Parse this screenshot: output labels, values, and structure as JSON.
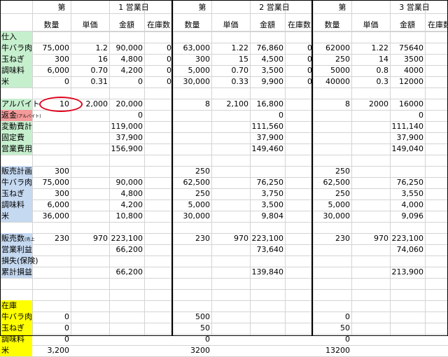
{
  "colors": {
    "green": "#c6efce",
    "blue": "#c5d9f1",
    "pink": "#f49a9a",
    "yellow": "#ffff00",
    "circle": "#e2001a",
    "grid": "#d4d4d4"
  },
  "days": [
    {
      "prefix": "第",
      "title": "1 営業日"
    },
    {
      "prefix": "第",
      "title": "2 営業日"
    },
    {
      "prefix": "第",
      "title": "3 営業日"
    }
  ],
  "column_headers": [
    "数量",
    "単価",
    "金額",
    "在庫数"
  ],
  "rows": [
    {
      "label": "仕入",
      "bg": "green",
      "cells": [
        [
          "",
          "",
          "",
          ""
        ],
        [
          "",
          "",
          "",
          ""
        ],
        [
          "",
          "",
          "",
          ""
        ]
      ]
    },
    {
      "label": "牛バラ肉",
      "bg": "green",
      "cells": [
        [
          "75,000",
          "1.2",
          "90,000",
          "0"
        ],
        [
          "63,000",
          "1.22",
          "76,860",
          "0"
        ],
        [
          "62000",
          "1.22",
          "75640",
          "0"
        ]
      ]
    },
    {
      "label": "玉ねぎ",
      "bg": "green",
      "cells": [
        [
          "300",
          "16",
          "4,800",
          "0"
        ],
        [
          "300",
          "15",
          "4,500",
          "0"
        ],
        [
          "250",
          "14",
          "3500",
          "0"
        ]
      ]
    },
    {
      "label": "調味料",
      "bg": "green",
      "cells": [
        [
          "6,000",
          "0.70",
          "4,200",
          "0"
        ],
        [
          "5,000",
          "0.70",
          "3,500",
          "0"
        ],
        [
          "5000",
          "0.8",
          "4000",
          "0"
        ]
      ]
    },
    {
      "label": "米",
      "bg": "green",
      "cells": [
        [
          "0",
          "0.31",
          "0",
          "0"
        ],
        [
          "30,000",
          "0.33",
          "9,900",
          "0"
        ],
        [
          "40000",
          "0.3",
          "12000",
          "0"
        ]
      ]
    },
    {
      "label": "",
      "bg": "",
      "cells": [
        [
          "",
          "",
          "",
          ""
        ],
        [
          "",
          "",
          "",
          ""
        ],
        [
          "",
          "",
          "",
          ""
        ]
      ]
    },
    {
      "label": "アルバイト",
      "bg": "green",
      "cells": [
        [
          "10",
          "2,000",
          "20,000",
          ""
        ],
        [
          "8",
          "2,100",
          "16,800",
          ""
        ],
        [
          "8",
          "2000",
          "16000",
          ""
        ]
      ]
    },
    {
      "label": "返金",
      "label_small": "(アルバイト)",
      "bg": "pink",
      "cells": [
        [
          "",
          "",
          "0",
          ""
        ],
        [
          "",
          "",
          "0",
          ""
        ],
        [
          "",
          "",
          "0",
          ""
        ]
      ]
    },
    {
      "label": "変動費計",
      "bg": "green",
      "cells": [
        [
          "",
          "",
          "119,000",
          ""
        ],
        [
          "",
          "",
          "111,560",
          ""
        ],
        [
          "",
          "",
          "111,140",
          ""
        ]
      ]
    },
    {
      "label": "固定費",
      "bg": "green",
      "cells": [
        [
          "",
          "",
          "37,900",
          ""
        ],
        [
          "",
          "",
          "37,900",
          ""
        ],
        [
          "",
          "",
          "37,900",
          ""
        ]
      ]
    },
    {
      "label": "営業費用",
      "bg": "green",
      "cells": [
        [
          "",
          "",
          "156,900",
          ""
        ],
        [
          "",
          "",
          "149,460",
          ""
        ],
        [
          "",
          "",
          "149,040",
          ""
        ]
      ]
    },
    {
      "label": "",
      "bg": "",
      "cells": [
        [
          "",
          "",
          "",
          ""
        ],
        [
          "",
          "",
          "",
          ""
        ],
        [
          "",
          "",
          "",
          ""
        ]
      ]
    },
    {
      "label": "販売計画",
      "bg": "blue",
      "cells": [
        [
          "300",
          "",
          "",
          ""
        ],
        [
          "250",
          "",
          "",
          ""
        ],
        [
          "250",
          "",
          "",
          ""
        ]
      ]
    },
    {
      "label": "牛バラ肉",
      "bg": "blue",
      "cells": [
        [
          "75,000",
          "",
          "90,000",
          ""
        ],
        [
          "62,500",
          "",
          "76,250",
          ""
        ],
        [
          "62,500",
          "",
          "76,250",
          ""
        ]
      ]
    },
    {
      "label": "玉ねぎ",
      "bg": "blue",
      "cells": [
        [
          "300",
          "",
          "4,800",
          ""
        ],
        [
          "250",
          "",
          "3,750",
          ""
        ],
        [
          "250",
          "",
          "3,550",
          ""
        ]
      ]
    },
    {
      "label": "調味料",
      "bg": "blue",
      "cells": [
        [
          "6,000",
          "",
          "4,200",
          ""
        ],
        [
          "5,000",
          "",
          "3,500",
          ""
        ],
        [
          "5,000",
          "",
          "4,000",
          ""
        ]
      ]
    },
    {
      "label": "米",
      "bg": "blue",
      "cells": [
        [
          "36,000",
          "",
          "10,800",
          ""
        ],
        [
          "30,000",
          "",
          "9,804",
          ""
        ],
        [
          "30,000",
          "",
          "9,096",
          ""
        ]
      ]
    },
    {
      "label": "",
      "bg": "",
      "cells": [
        [
          "",
          "",
          "",
          ""
        ],
        [
          "",
          "",
          "",
          ""
        ],
        [
          "",
          "",
          "",
          ""
        ]
      ]
    },
    {
      "label": "販売数",
      "label_small": "(売上",
      "bg": "blue",
      "cells": [
        [
          "230",
          "970",
          "223,100",
          ""
        ],
        [
          "230",
          "970",
          "223,100",
          ""
        ],
        [
          "230",
          "970",
          "223,100",
          ""
        ]
      ]
    },
    {
      "label": "営業利益",
      "bg": "blue",
      "cells": [
        [
          "",
          "",
          "66,200",
          ""
        ],
        [
          "",
          "",
          "73,640",
          ""
        ],
        [
          "",
          "",
          "74,060",
          ""
        ]
      ]
    },
    {
      "label": "損失(保険)",
      "bg": "blue",
      "cells": [
        [
          "",
          "",
          "",
          ""
        ],
        [
          "",
          "",
          "",
          ""
        ],
        [
          "",
          "",
          "",
          ""
        ]
      ]
    },
    {
      "label": "累計損益",
      "bg": "blue",
      "cells": [
        [
          "",
          "",
          "66,200",
          ""
        ],
        [
          "",
          "",
          "139,840",
          ""
        ],
        [
          "",
          "",
          "213,900",
          ""
        ]
      ]
    },
    {
      "label": "",
      "bg": "",
      "cells": [
        [
          "",
          "",
          "",
          ""
        ],
        [
          "",
          "",
          "",
          ""
        ],
        [
          "",
          "",
          "",
          ""
        ]
      ]
    },
    {
      "label": "",
      "bg": "",
      "cells": [
        [
          "",
          "",
          "",
          ""
        ],
        [
          "",
          "",
          "",
          ""
        ],
        [
          "",
          "",
          "",
          ""
        ]
      ]
    },
    {
      "label": "在庫",
      "bg": "yellow",
      "cells": [
        [
          "",
          "",
          "",
          ""
        ],
        [
          "",
          "",
          "",
          ""
        ],
        [
          "",
          "",
          "",
          ""
        ]
      ]
    },
    {
      "label": "牛バラ肉",
      "bg": "yellow",
      "cells": [
        [
          "0",
          "",
          "",
          ""
        ],
        [
          "500",
          "",
          "",
          ""
        ],
        [
          "0",
          "",
          "",
          ""
        ]
      ]
    },
    {
      "label": "玉ねぎ",
      "bg": "yellow",
      "cells": [
        [
          "0",
          "",
          "",
          ""
        ],
        [
          "50",
          "",
          "",
          ""
        ],
        [
          "50",
          "",
          "",
          ""
        ]
      ]
    },
    {
      "label": "調味料",
      "bg": "yellow",
      "cells": [
        [
          "0",
          "",
          "",
          ""
        ],
        [
          "0",
          "",
          "",
          ""
        ],
        [
          "0",
          "",
          "",
          ""
        ]
      ]
    },
    {
      "label": "米",
      "bg": "yellow",
      "cells": [
        [
          "3,200",
          "",
          "",
          ""
        ],
        [
          "3200",
          "",
          "",
          ""
        ],
        [
          "13200",
          "",
          "",
          ""
        ]
      ]
    }
  ]
}
